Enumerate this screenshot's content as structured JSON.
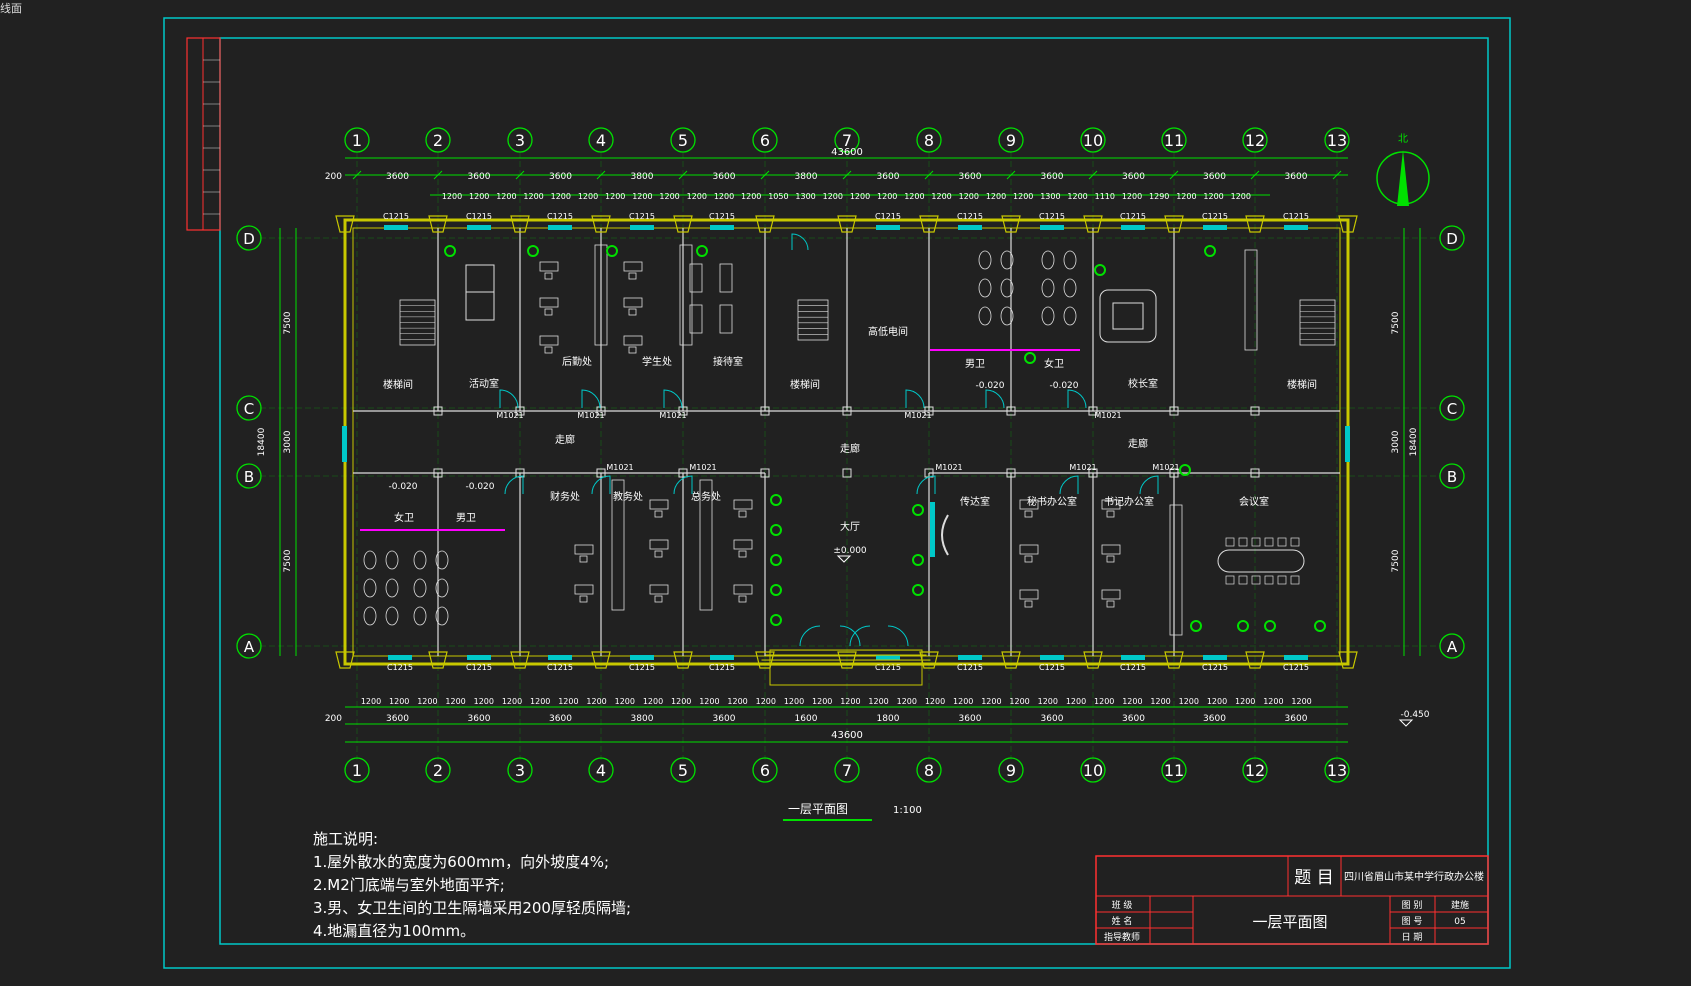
{
  "window": {
    "corner_label": "线面"
  },
  "plan": {
    "title": "一层平面图",
    "scale": "1:100",
    "total_dim": "43600",
    "depth_dim": "18400",
    "axis_cols": [
      "1",
      "2",
      "3",
      "4",
      "5",
      "6",
      "7",
      "8",
      "9",
      "10",
      "11",
      "12",
      "13"
    ],
    "axis_rows": [
      "D",
      "C",
      "B",
      "A"
    ],
    "top_dims": [
      "3600",
      "3600",
      "3600",
      "3800",
      "3600",
      "3800",
      "3600",
      "3600",
      "3600",
      "3600",
      "3600",
      "3600"
    ],
    "top_start": "200",
    "side_dims": [
      "7500",
      "3000",
      "7500"
    ],
    "rooms": {
      "stair_left": "楼梯间",
      "activity": "活动室",
      "logistics": "后勤处",
      "student": "学生处",
      "reception": "接待室",
      "stair_mid": "楼梯间",
      "distribution": "高低电间",
      "men_wc_top": "男卫",
      "women_wc_top": "女卫",
      "principal": "校长室",
      "stair_right": "楼梯间",
      "women_wc": "女卫",
      "men_wc": "男卫",
      "finance": "财务处",
      "teaching": "教务处",
      "general": "总务处",
      "hall": "大厅",
      "duty": "传达室",
      "secretary": "秘书办公室",
      "party": "书记办公室",
      "meeting": "会议室",
      "corridor_left": "走廊",
      "corridor_mid": "走廊",
      "corridor_right": "走廊"
    },
    "elevations": {
      "hall": "±0.000",
      "outside": "-0.450",
      "wc1": "-0.020",
      "wc2": "-0.020",
      "wc3": "-0.020",
      "wc4": "-0.020"
    },
    "window_tag": "C1215",
    "door_tag": "M1021"
  },
  "notes": {
    "heading": "施工说明:",
    "items": [
      "1.屋外散水的宽度为600mm，向外坡度4%;",
      "2.M2门底端与室外地面平齐;",
      "3.男、女卫生间的卫生隔墙采用200厚轻质隔墙;",
      "4.地漏直径为100mm。"
    ]
  },
  "title_block": {
    "label_title": "题  目",
    "project": "四川省眉山市某中学行政办公楼",
    "drawing_name": "一层平面图",
    "class_label": "班  级",
    "name_label": "姓  名",
    "advisor_label": "指导教师",
    "fig_label": "图  别",
    "fig_value": "建施",
    "num_label": "图  号",
    "num_value": "05",
    "date_label": "日  期"
  },
  "north_label": "北",
  "colors": {
    "bg": "#212121",
    "frame": "#00c8c8",
    "grid": "#00e000",
    "wall": "#d8d800",
    "text": "#ffffff",
    "red": "#ff3030",
    "magenta": "#ff00ff"
  }
}
